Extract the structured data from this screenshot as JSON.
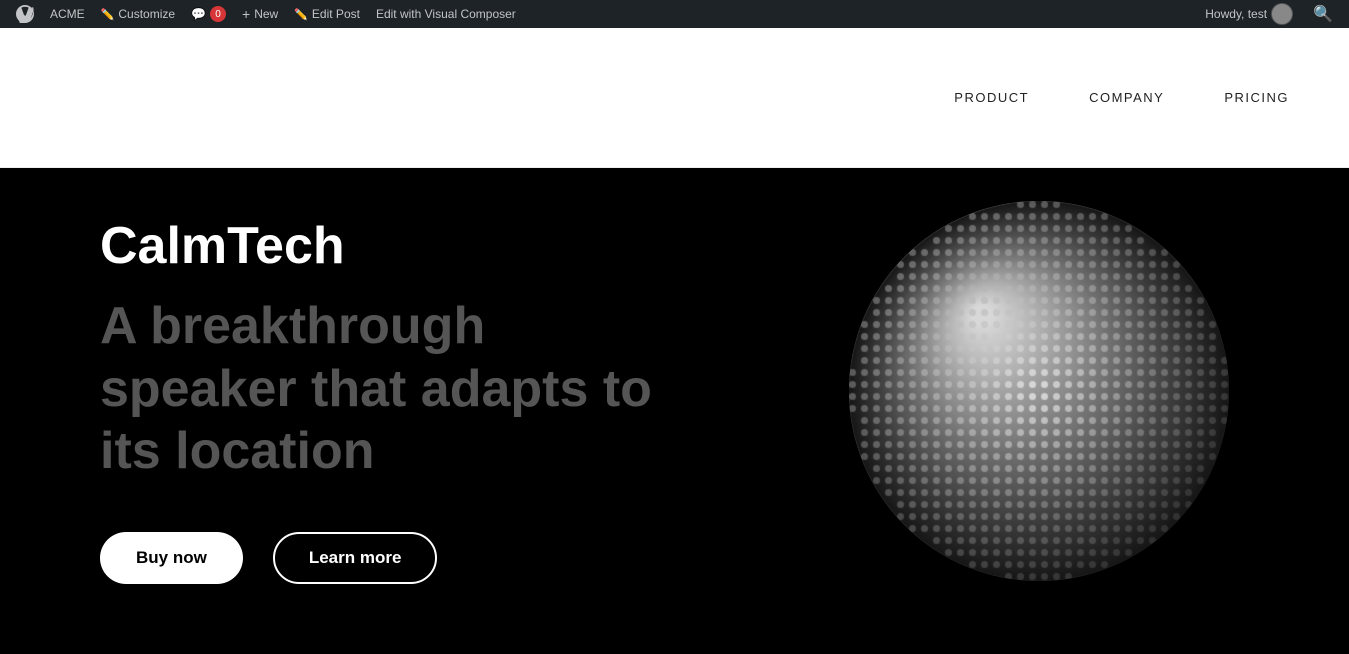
{
  "admin_bar": {
    "wp_icon": "W",
    "site_name": "ACME",
    "customize_label": "Customize",
    "comments_label": "0",
    "new_label": "New",
    "edit_post_label": "Edit Post",
    "visual_composer_label": "Edit with Visual Composer",
    "howdy_label": "Howdy, test"
  },
  "nav": {
    "product": "PRODUCT",
    "company": "COMPANY",
    "pricing": "PRICING"
  },
  "hero": {
    "brand": "CalmTech",
    "tagline": "A breakthrough speaker that adapts to its location",
    "buy_btn": "Buy now",
    "learn_btn": "Learn more"
  }
}
